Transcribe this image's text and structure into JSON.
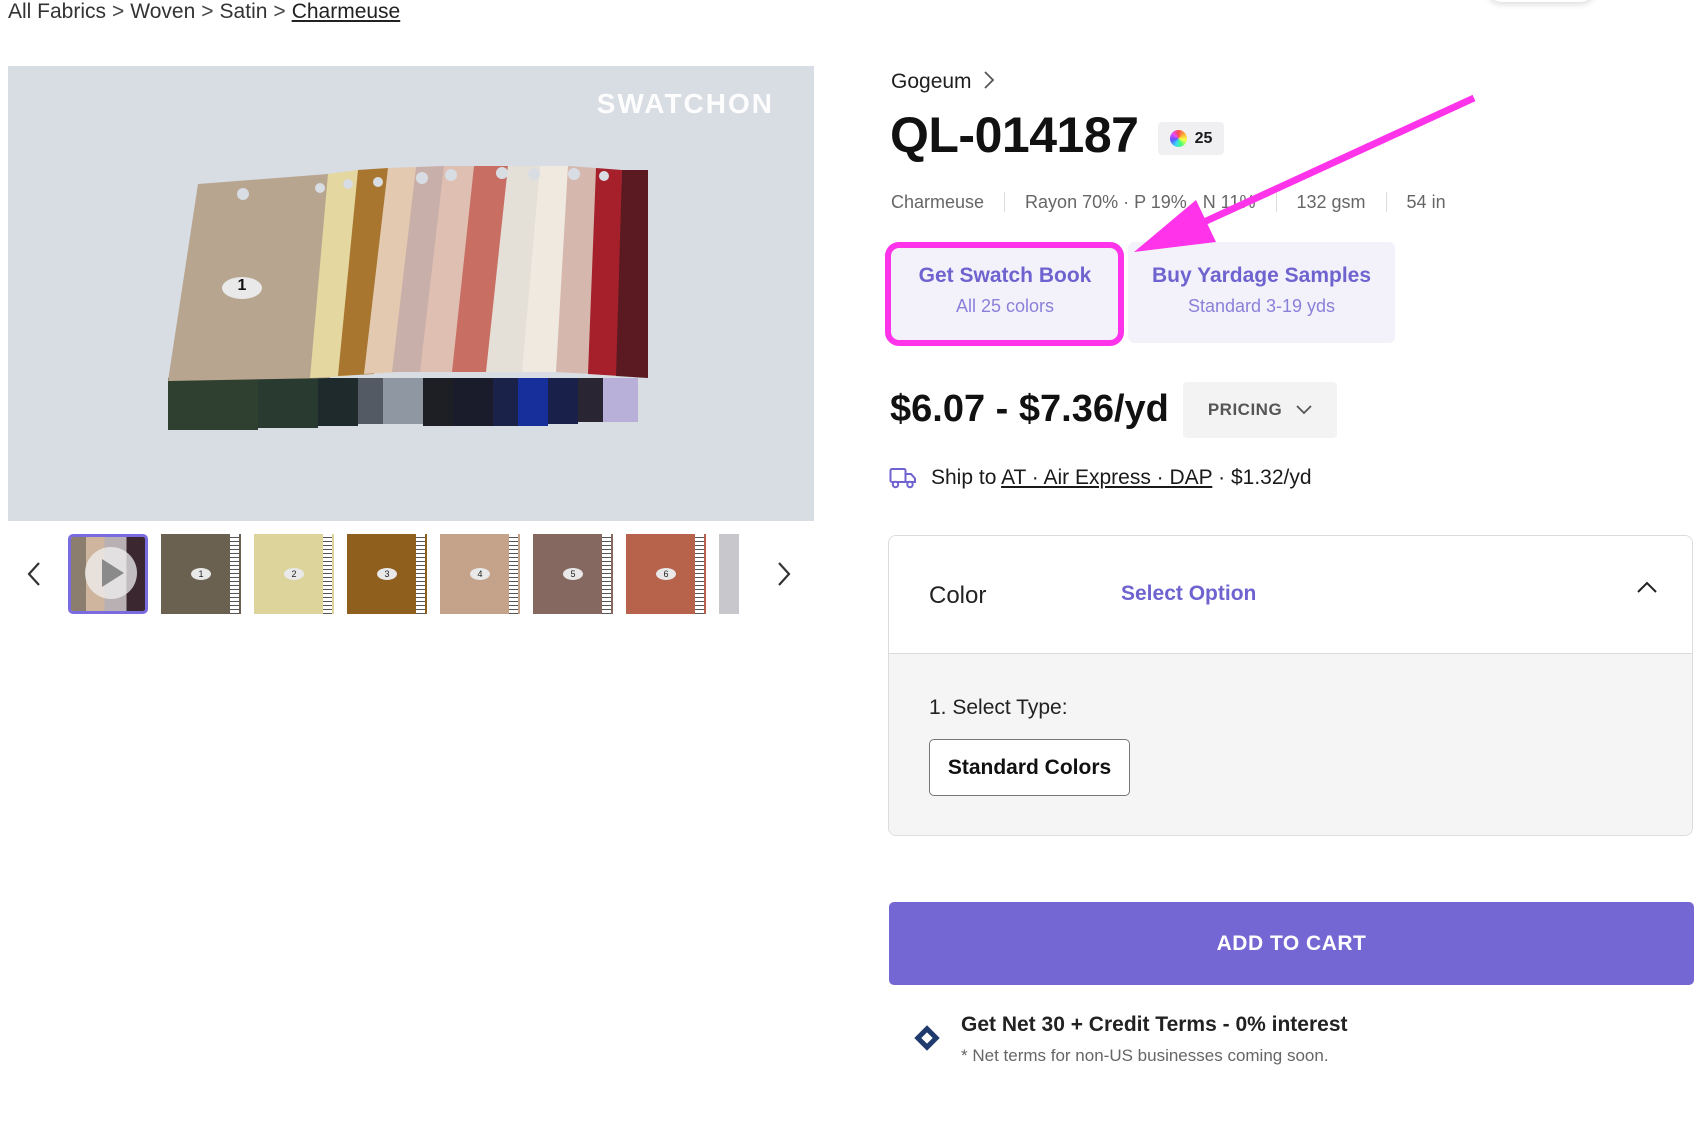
{
  "breadcrumb": {
    "items": [
      "All Fabrics",
      "Woven",
      "Satin",
      "Charmeuse"
    ],
    "separator": ">"
  },
  "gallery": {
    "watermark": "SWATCHON",
    "main_swatch_label": "1",
    "thumbnails": [
      {
        "type": "video",
        "label": ""
      },
      {
        "type": "image",
        "label": "1",
        "color": "#6b6151"
      },
      {
        "type": "image",
        "label": "2",
        "color": "#dcd49b"
      },
      {
        "type": "image",
        "label": "3",
        "color": "#8f5f1e"
      },
      {
        "type": "image",
        "label": "4",
        "color": "#c5a38a"
      },
      {
        "type": "image",
        "label": "5",
        "color": "#85685f"
      },
      {
        "type": "image",
        "label": "6",
        "color": "#b7624b"
      },
      {
        "type": "image",
        "label": "",
        "color": "#c8c8cc"
      }
    ],
    "prev_icon": "chevron-left-icon",
    "next_icon": "chevron-right-icon"
  },
  "product": {
    "supplier": "Gogeum",
    "code": "QL-014187",
    "color_count": "25",
    "specs": [
      "Charmeuse",
      "Rayon 70% · P 19% · N 11%",
      "132 gsm",
      "54 in"
    ]
  },
  "options": {
    "swatch_book": {
      "title": "Get Swatch Book",
      "subtitle": "All 25 colors"
    },
    "yardage": {
      "title": "Buy Yardage Samples",
      "subtitle": "Standard 3-19 yds"
    }
  },
  "pricing": {
    "price_range": "$6.07 - $7.36/yd",
    "button_label": "PRICING"
  },
  "shipping": {
    "prefix": "Ship to",
    "method": "AT · Air Express · DAP",
    "cost": "· $1.32/yd"
  },
  "color_selector": {
    "label": "Color",
    "placeholder": "Select Option",
    "step_label": "1. Select Type:",
    "type_option": "Standard Colors"
  },
  "cart": {
    "button_label": "ADD TO CART"
  },
  "net_terms": {
    "title": "Get Net 30 + Credit Terms - 0% interest",
    "note": "* Net terms for non-US businesses coming soon."
  },
  "colors": {
    "accent": "#7467d3",
    "accent_text": "#6f63cf",
    "highlight": "#ff33e9",
    "option_bg": "#f3f2fb"
  }
}
